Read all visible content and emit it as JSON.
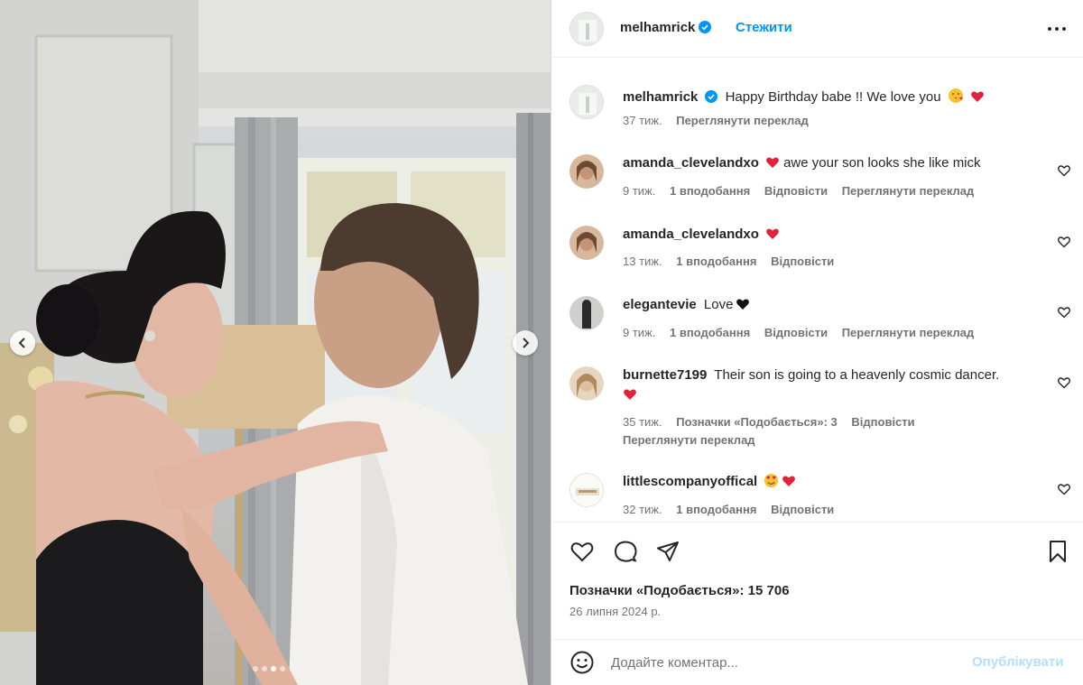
{
  "post": {
    "author": "melhamrick",
    "follow_label": "Стежити",
    "image_alt": "Photo"
  },
  "caption": {
    "username": "melhamrick",
    "text": "Happy Birthday babe !! We love you",
    "time": "37 тиж.",
    "translate": "Переглянути переклад"
  },
  "comments": [
    {
      "username": "amanda_clevelandxo",
      "text": "awe your son looks she like mick",
      "time": "9 тиж.",
      "likes": "1 вподобання",
      "reply": "Відповісти",
      "translate": "Переглянути переклад"
    },
    {
      "username": "amanda_clevelandxo",
      "text": "",
      "time": "13 тиж.",
      "likes": "1 вподобання",
      "reply": "Відповісти"
    },
    {
      "username": "elegantevie",
      "text": "Love",
      "time": "9 тиж.",
      "likes": "1 вподобання",
      "reply": "Відповісти",
      "translate": "Переглянути переклад"
    },
    {
      "username": "burnette7199",
      "text": "Their son is going to a heavenly cosmic dancer.",
      "time": "35 тиж.",
      "likes": "Позначки «Подобається»: 3",
      "reply": "Відповісти",
      "translate": "Переглянути переклад"
    },
    {
      "username": "littlescompanyoffical",
      "text": "",
      "time": "32 тиж.",
      "likes": "1 вподобання",
      "reply": "Відповісти"
    }
  ],
  "footer": {
    "likes": "Позначки «Подобається»: 15 706",
    "date": "26 липня 2024 р."
  },
  "add_comment": {
    "placeholder": "Додайте коментар...",
    "post_label": "Опублікувати"
  },
  "icons": {
    "verified": "verified-badge-icon",
    "more": "more-options-icon",
    "like": "heart-outline-icon",
    "comment": "comment-bubble-icon",
    "share": "paper-plane-icon",
    "save": "bookmark-icon",
    "emoji": "smiley-icon"
  },
  "colors": {
    "accent": "#0095f6",
    "heart": "#ed4956",
    "muted": "#737373"
  },
  "carousel": {
    "slides": 4,
    "active": 2
  }
}
